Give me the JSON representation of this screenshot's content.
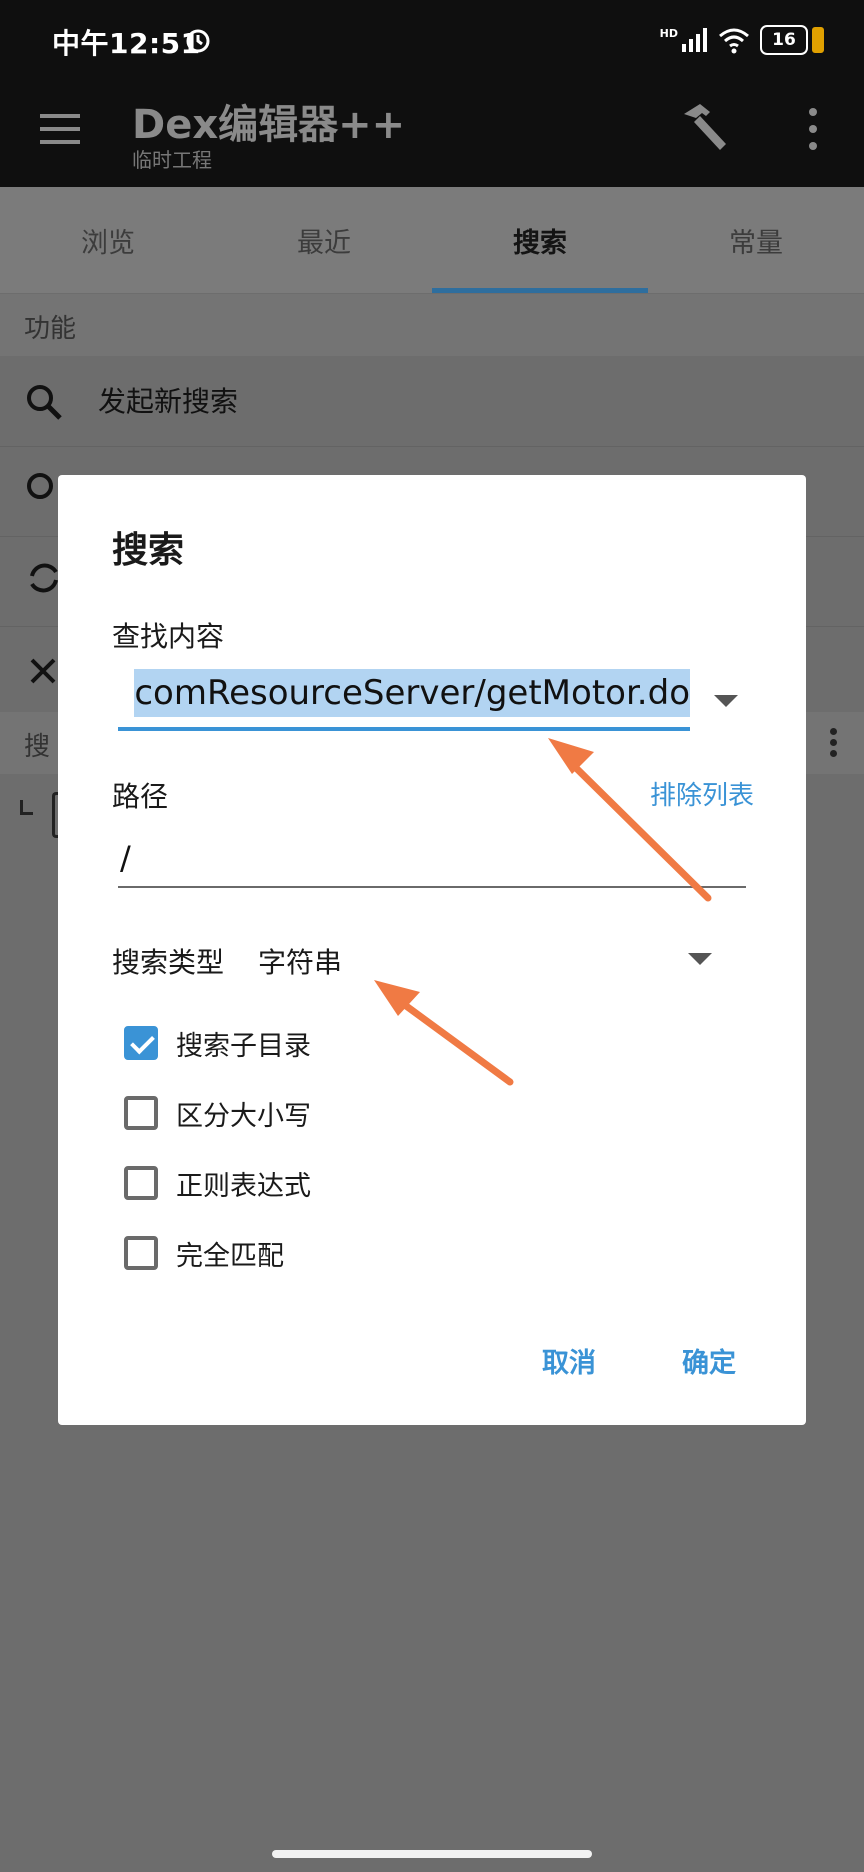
{
  "status_bar": {
    "time": "中午12:51",
    "battery": "16",
    "network_label": "HD"
  },
  "app_bar": {
    "title": "Dex编辑器++",
    "subtitle": "临时工程"
  },
  "tabs": [
    {
      "label": "浏览",
      "active": false
    },
    {
      "label": "最近",
      "active": false
    },
    {
      "label": "搜索",
      "active": true
    },
    {
      "label": "常量",
      "active": false
    }
  ],
  "background": {
    "section_label": "功能",
    "rows": [
      {
        "label": "发起新搜索"
      }
    ],
    "section2_label": "搜"
  },
  "dialog": {
    "title": "搜索",
    "find_label": "查找内容",
    "find_value": "comResourceServer/getMotor.do",
    "path_label": "路径",
    "exclude_link": "排除列表",
    "path_value": "/",
    "type_label": "搜索类型",
    "type_value": "字符串",
    "options": [
      {
        "label": "搜索子目录",
        "checked": true
      },
      {
        "label": "区分大小写",
        "checked": false
      },
      {
        "label": "正则表达式",
        "checked": false
      },
      {
        "label": "完全匹配",
        "checked": false
      }
    ],
    "cancel_label": "取消",
    "ok_label": "确定"
  },
  "colors": {
    "accent": "#3a93d6",
    "annotation_arrow": "#f07a44",
    "tab_indicator": "#2e6e9e"
  }
}
